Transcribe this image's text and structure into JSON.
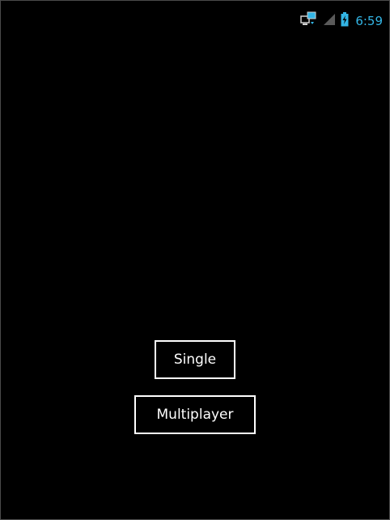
{
  "status_bar": {
    "time": "6:59",
    "icons": [
      "network-sync-icon",
      "signal-icon",
      "battery-charging-icon"
    ],
    "accent_color": "#33b5e5"
  },
  "menu": {
    "single_label": "Single",
    "multiplayer_label": "Multiplayer"
  },
  "colors": {
    "background": "#000000",
    "button_border": "#ffffff",
    "button_text": "#ffffff"
  }
}
